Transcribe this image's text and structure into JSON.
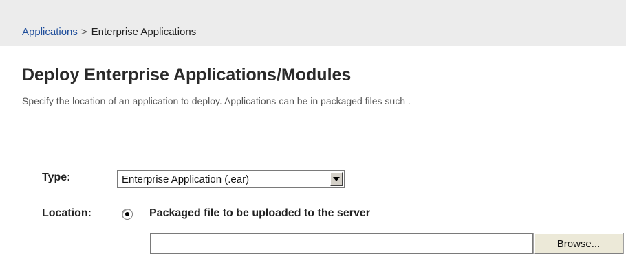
{
  "breadcrumb": {
    "parent": "Applications",
    "separator": ">",
    "current": "Enterprise Applications"
  },
  "page": {
    "title": "Deploy Enterprise Applications/Modules",
    "description": "Specify the location of an application to deploy. Applications can be in packaged files such ."
  },
  "form": {
    "type_label": "Type:",
    "type_value": "Enterprise Application (.ear)",
    "location_label": "Location:",
    "location_option": "Packaged file to be uploaded to the server",
    "location_option_selected": true,
    "file_value": "",
    "browse_label": "Browse..."
  },
  "colors": {
    "breadcrumb_bar": "#ececec",
    "link": "#1f4e9b",
    "title": "#2a2a2a",
    "description": "#555555"
  },
  "icons": {
    "dropdown": "chevron-down-icon",
    "radio": "radio-selected-icon"
  }
}
